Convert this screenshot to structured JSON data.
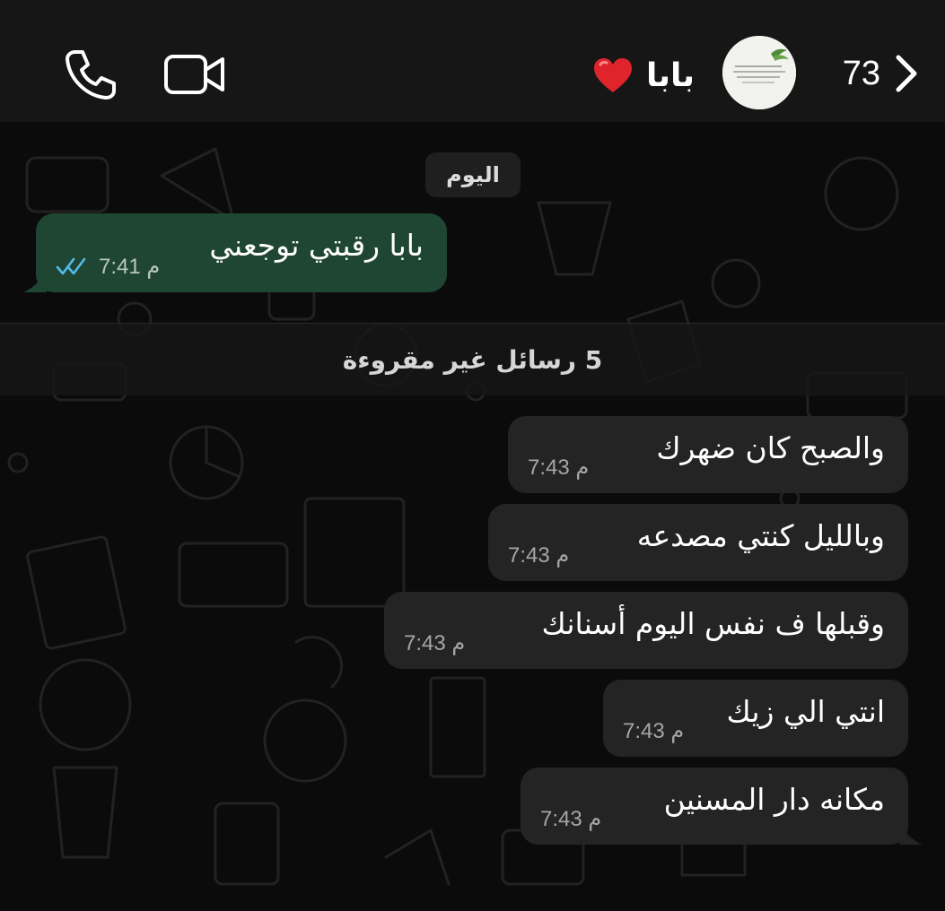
{
  "header": {
    "back_count": "73",
    "contact_name": "بابا",
    "contact_emoji": "heart",
    "icons": [
      "chevron-left-icon",
      "phone-icon",
      "video-camera-icon",
      "heart-icon"
    ]
  },
  "chat": {
    "date_chip": "اليوم",
    "unread_divider": "5 رسائل غير مقروءة",
    "messages": [
      {
        "direction": "outgoing",
        "text": "بابا رقبتي توجعني",
        "time": "7:41 م",
        "status": "read"
      },
      {
        "direction": "incoming",
        "text": "والصبح كان ضهرك",
        "time": "7:43 م"
      },
      {
        "direction": "incoming",
        "text": "وبالليل كنتي مصدعه",
        "time": "7:43 م"
      },
      {
        "direction": "incoming",
        "text": "وقبلها ف نفس اليوم أسنانك",
        "time": "7:43 م"
      },
      {
        "direction": "incoming",
        "text": "انتي الي زيك",
        "time": "7:43 م"
      },
      {
        "direction": "incoming",
        "text": "مكانه دار المسنين",
        "time": "7:43 م"
      }
    ]
  },
  "colors": {
    "outgoing_bubble": "#1e4632",
    "incoming_bubble": "#242424",
    "header_bg": "#161616",
    "chat_bg": "#0b0b0b",
    "read_ticks": "#53bdeb",
    "heart": "#e0242b"
  }
}
